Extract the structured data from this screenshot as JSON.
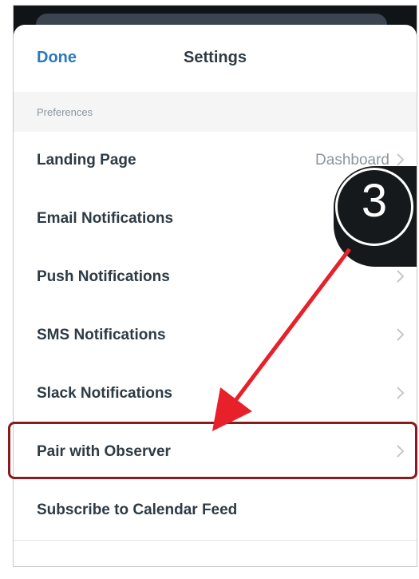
{
  "header": {
    "done_label": "Done",
    "title": "Settings"
  },
  "section": {
    "label": "Preferences"
  },
  "rows": [
    {
      "label": "Landing Page",
      "value": "Dashboard"
    },
    {
      "label": "Email Notifications"
    },
    {
      "label": "Push Notifications"
    },
    {
      "label": "SMS Notifications"
    },
    {
      "label": "Slack Notifications"
    },
    {
      "label": "Pair with Observer"
    },
    {
      "label": "Subscribe to Calendar Feed"
    }
  ],
  "annotation": {
    "step_number": "3",
    "arrow_color": "#e8202a",
    "highlight_color": "#8b1a1e"
  },
  "icons": {
    "chevron": "chevron-right-icon"
  }
}
